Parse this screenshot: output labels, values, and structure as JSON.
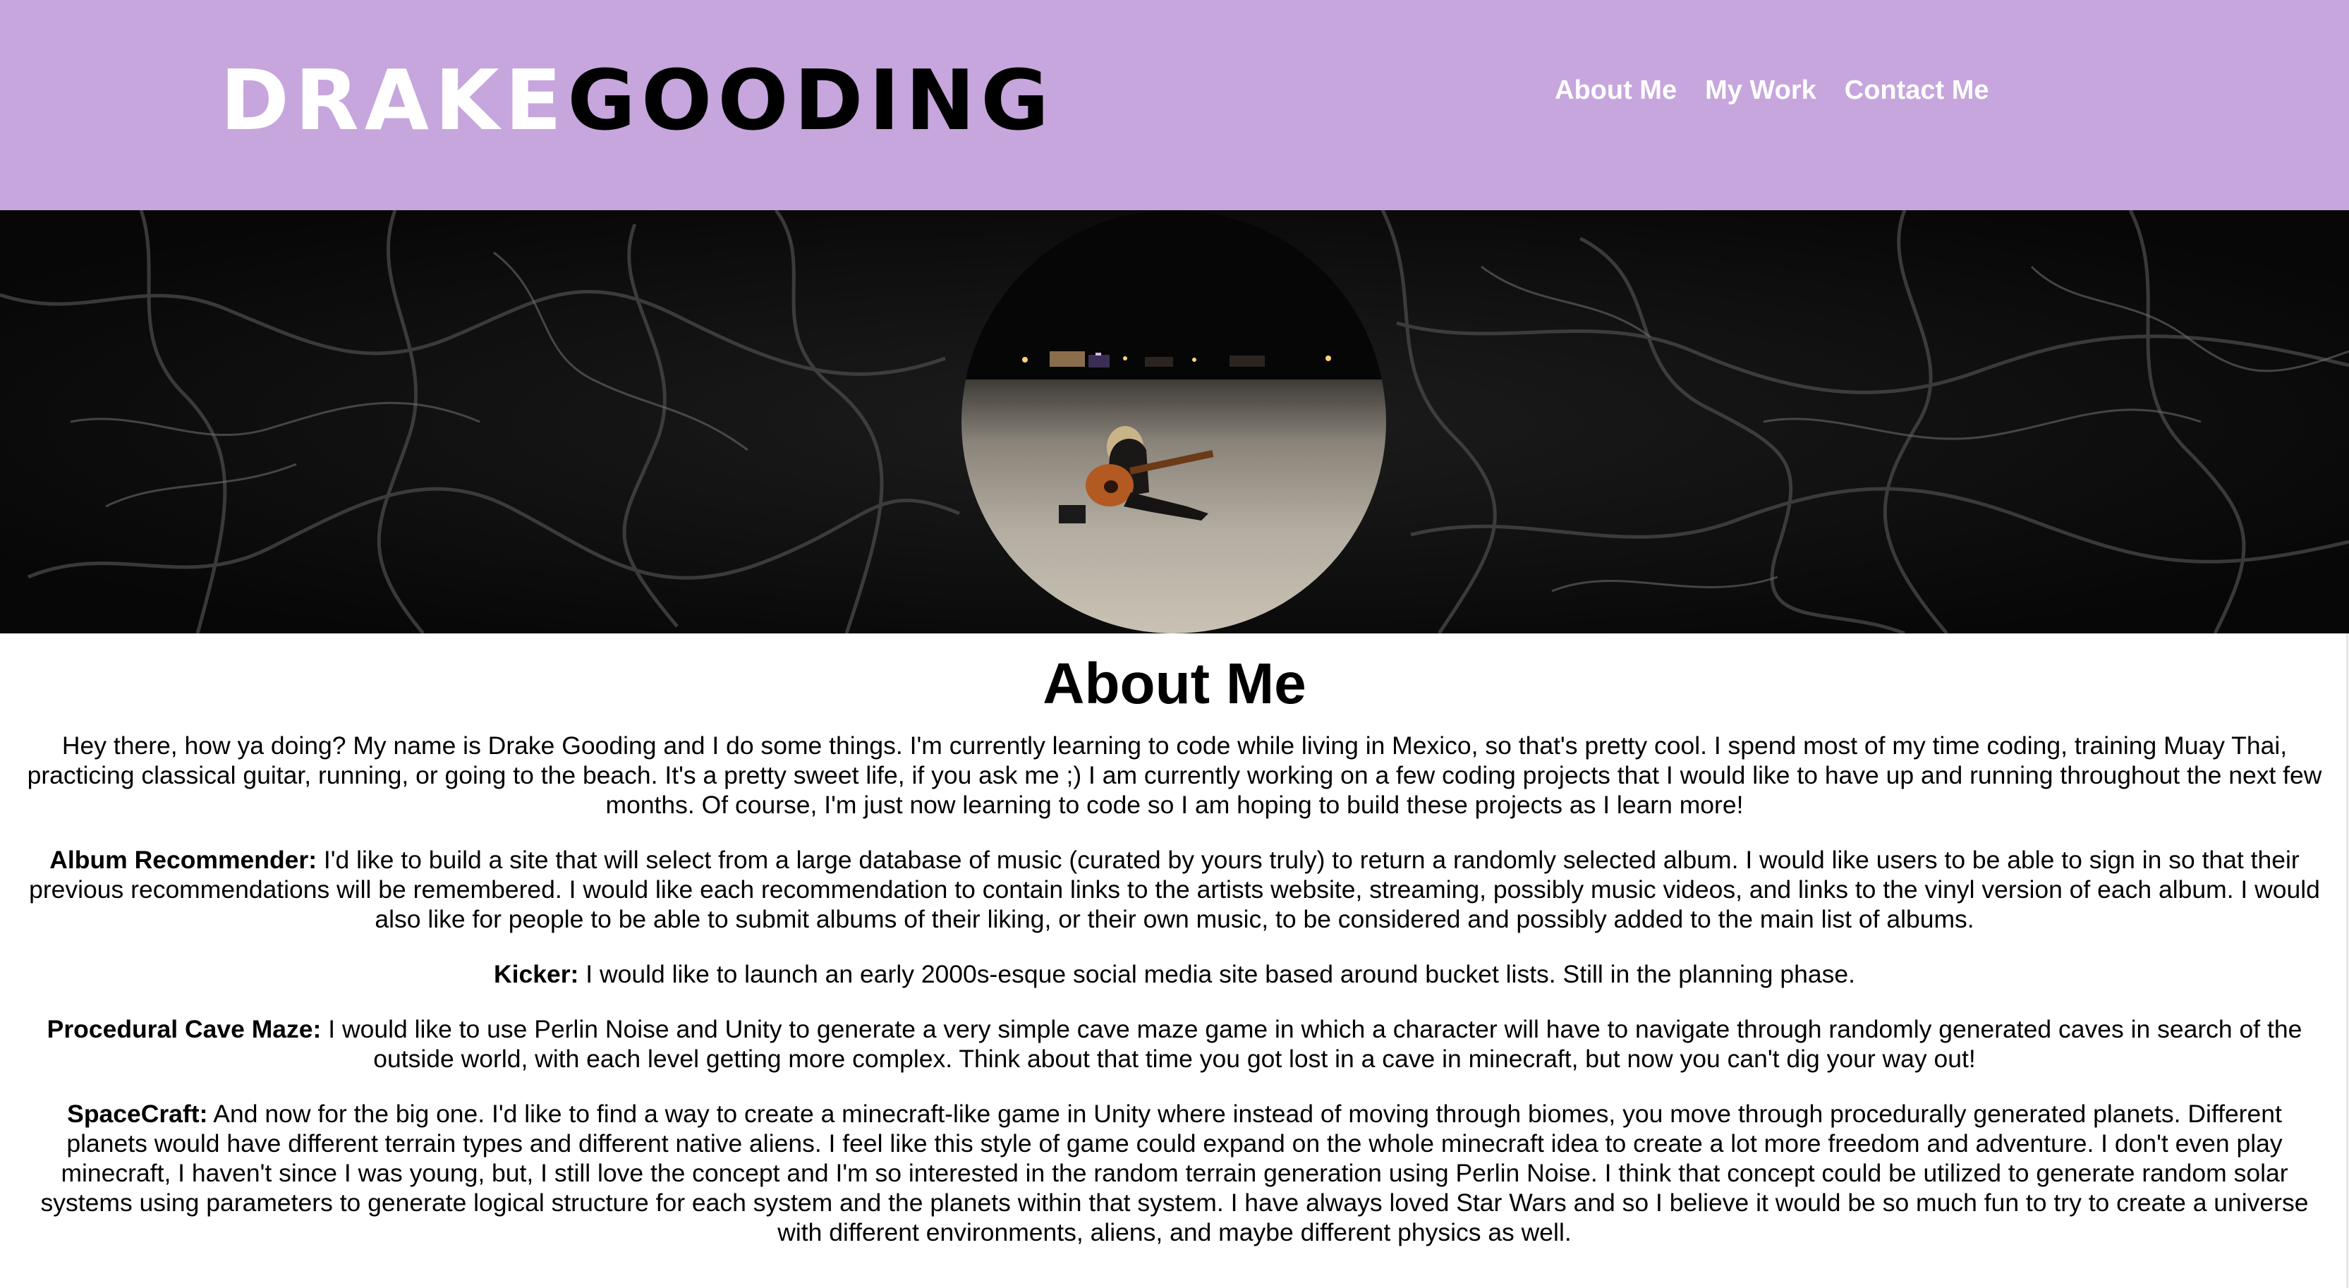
{
  "header": {
    "logo": {
      "first": "DRAKE",
      "last": "GOODING"
    },
    "nav": [
      {
        "label": "About Me"
      },
      {
        "label": "My Work"
      },
      {
        "label": "Contact Me"
      }
    ],
    "background_color": "#c6a6dd"
  },
  "hero": {
    "background": "dark marble texture",
    "portrait": "person playing guitar on a beach at night"
  },
  "main": {
    "title": "About Me",
    "intro": "Hey there, how ya doing? My name is Drake Gooding and I do some things. I'm currently learning to code while living in Mexico, so that's pretty cool. I spend most of my time coding, training Muay Thai, practicing classical guitar, running, or going to the beach. It's a pretty sweet life, if you ask me ;) I am currently working on a few coding projects that I would like to have up and running throughout the next few months. Of course, I'm just now learning to code so I am hoping to build these projects as I learn more!",
    "projects": [
      {
        "name": "Album Recommender:",
        "description": " I'd like to build a site that will select from a large database of music (curated by yours truly) to return a randomly selected album. I would like users to be able to sign in so that their previous recommendations will be remembered. I would like each recommendation to contain links to the artists website, streaming, possibly music videos, and links to the vinyl version of each album. I would also like for people to be able to submit albums of their liking, or their own music, to be considered and possibly added to the main list of albums."
      },
      {
        "name": "Kicker:",
        "description": " I would like to launch an early 2000s-esque social media site based around bucket lists. Still in the planning phase."
      },
      {
        "name": "Procedural Cave Maze:",
        "description": " I would like to use Perlin Noise and Unity to generate a very simple cave maze game in which a character will have to navigate through randomly generated caves in search of the outside world, with each level getting more complex. Think about that time you got lost in a cave in minecraft, but now you can't dig your way out!"
      },
      {
        "name": "SpaceCraft:",
        "description": " And now for the big one. I'd like to find a way to create a minecraft-like game in Unity where instead of moving through biomes, you move through procedurally generated planets. Different planets would have different terrain types and different native aliens. I feel like this style of game could expand on the whole minecraft idea to create a lot more freedom and adventure. I don't even play minecraft, I haven't since I was young, but, I still love the concept and I'm so interested in the random terrain generation using Perlin Noise. I think that concept could be utilized to generate random solar systems using parameters to generate logical structure for each system and the planets within that system. I have always loved Star Wars and so I believe it would be so much fun to try to create a universe with different environments, aliens, and maybe different physics as well."
      }
    ]
  }
}
